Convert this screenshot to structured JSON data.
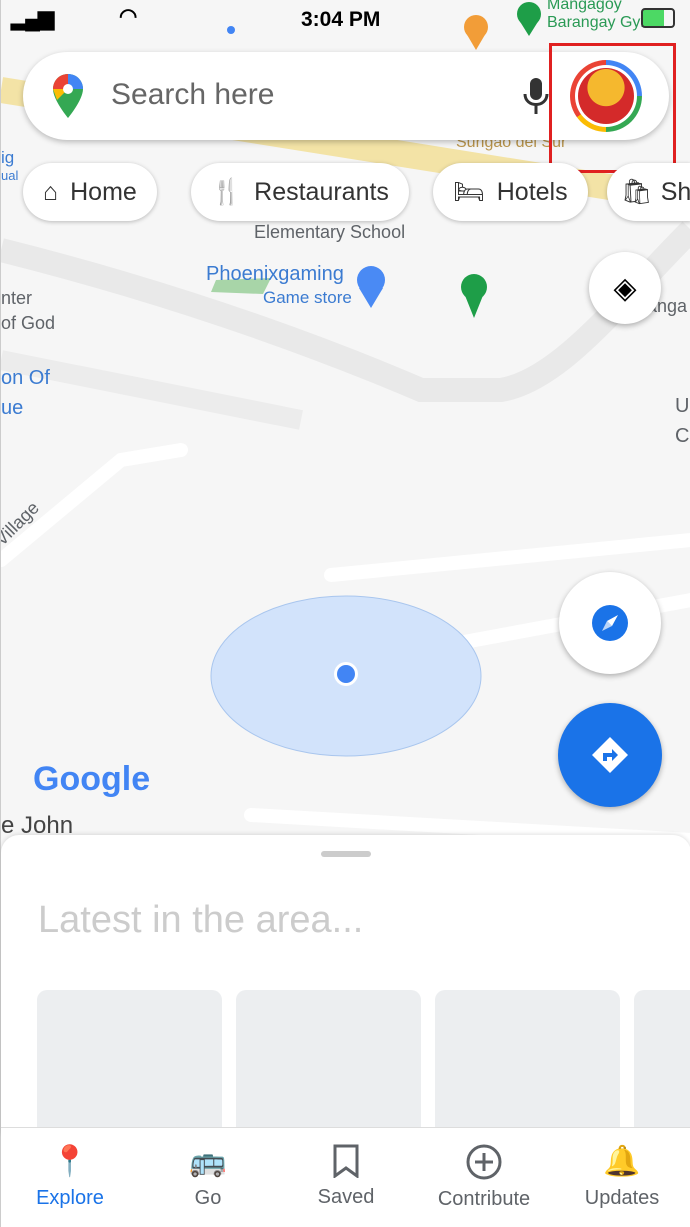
{
  "status": {
    "time": "3:04 PM"
  },
  "search": {
    "placeholder": "Search here"
  },
  "chips": [
    {
      "label": "Home",
      "icon": "home-icon"
    },
    {
      "label": "Restaurants",
      "icon": "fork-knife-icon"
    },
    {
      "label": "Hotels",
      "icon": "bed-icon"
    },
    {
      "label": "Sh",
      "icon": "shopping-bag-icon"
    }
  ],
  "map": {
    "labels": {
      "school": "Elementary School",
      "store": "Phoenixgaming",
      "store_type": "Game store",
      "gym1": "Mangagoy",
      "gym2": "Barangay Gym",
      "surigao": "Surigao del Sur",
      "nter": "nter",
      "god": "of God",
      "onof": "on Of",
      "ue": "ue",
      "village": "o Village",
      "john": "e John",
      "anga": "anga",
      "u": "U",
      "c": "C",
      "ig": "ig",
      "ual": "ual"
    },
    "logo": "Google"
  },
  "sheet": {
    "title": "Latest in the area..."
  },
  "nav": [
    {
      "label": "Explore",
      "active": true
    },
    {
      "label": "Go"
    },
    {
      "label": "Saved"
    },
    {
      "label": "Contribute"
    },
    {
      "label": "Updates"
    }
  ],
  "colors": {
    "accent": "#1a73e8",
    "highlight": "#e02020"
  }
}
